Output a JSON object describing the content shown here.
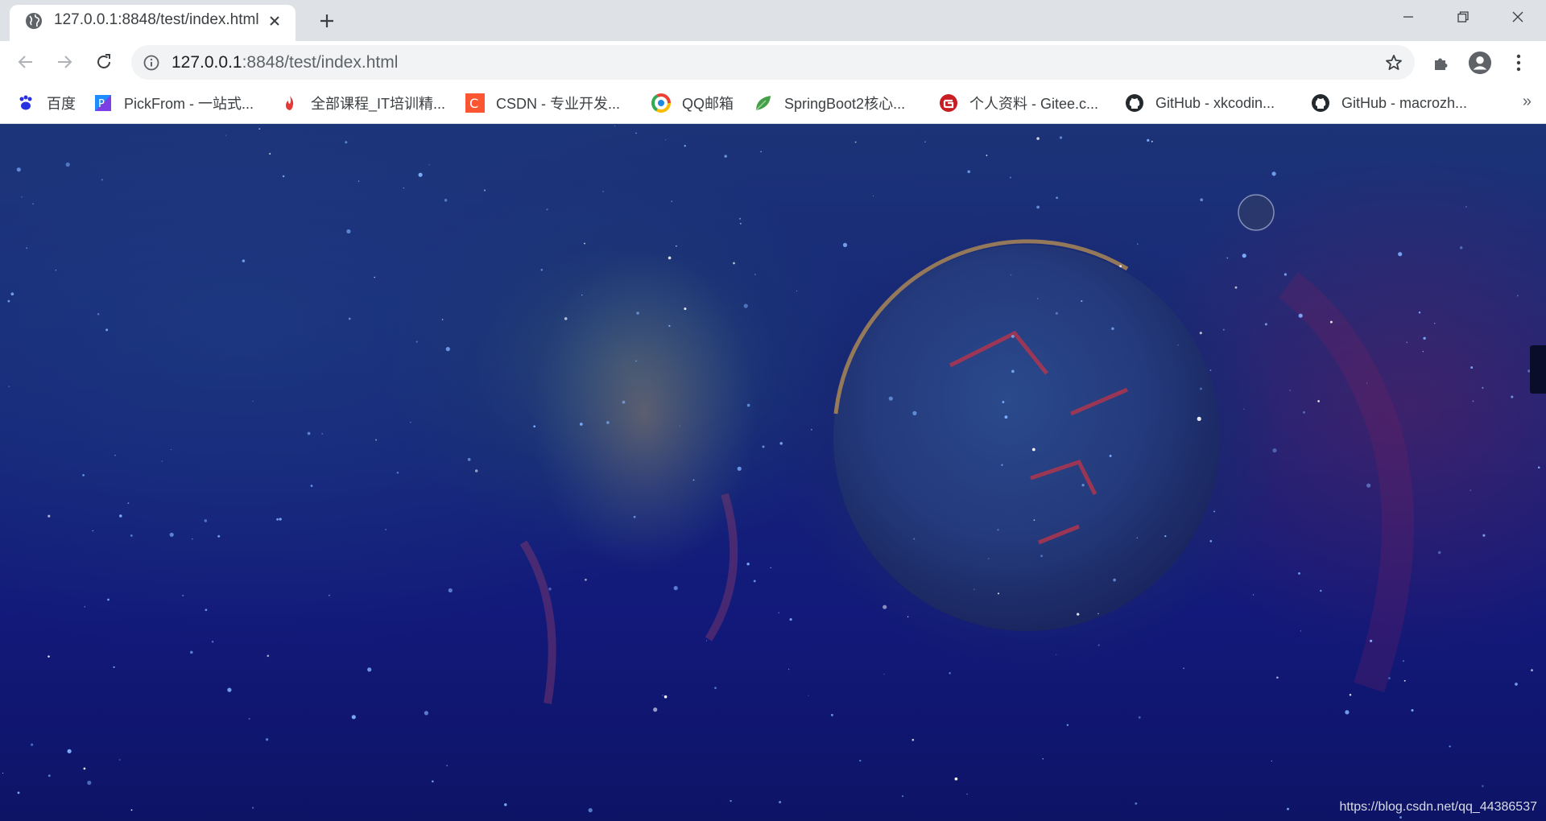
{
  "tab": {
    "title": "127.0.0.1:8848/test/index.html"
  },
  "omnibox": {
    "url_host": "127.0.0.1",
    "url_rest": ":8848/test/index.html"
  },
  "bookmarks": [
    {
      "label": "百度",
      "icon": "baidu-icon",
      "color": "#2932e1"
    },
    {
      "label": "PickFrom - 一站式...",
      "icon": "pickfrom-icon",
      "color": "#1f8bff"
    },
    {
      "label": "全部课程_IT培训精...",
      "icon": "flame-icon",
      "color": "#e53935"
    },
    {
      "label": "CSDN - 专业开发...",
      "icon": "csdn-icon",
      "color": "#fc5531"
    },
    {
      "label": "QQ邮箱",
      "icon": "qqmail-icon",
      "color": "#1e88e5"
    },
    {
      "label": "SpringBoot2核心...",
      "icon": "spring-leaf-icon",
      "color": "#43a047"
    },
    {
      "label": "个人资料 - Gitee.c...",
      "icon": "gitee-icon",
      "color": "#c71d23"
    },
    {
      "label": "GitHub - xkcodin...",
      "icon": "github-icon",
      "color": "#24292e"
    },
    {
      "label": "GitHub - macrozh...",
      "icon": "github-icon",
      "color": "#24292e"
    }
  ],
  "page": {
    "watermark": "https://blog.csdn.net/qq_44386537"
  },
  "colors": {
    "tabstrip": "#dee1e6",
    "toolbar": "#ffffff",
    "page_bg": "#16267a"
  }
}
